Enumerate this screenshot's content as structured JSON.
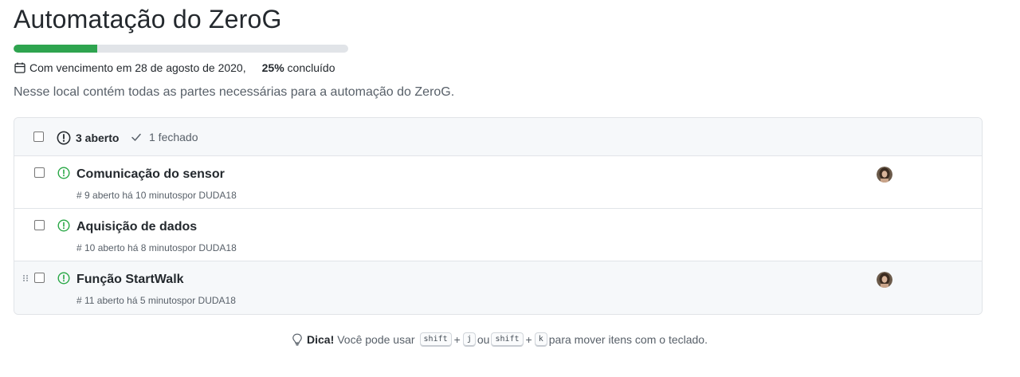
{
  "milestone": {
    "title": "Automatação do ZeroG",
    "progress": 0.25,
    "due_text": "Com vencimento em 28 de agosto de 2020,",
    "percent_value": "25%",
    "percent_label": "concluído",
    "description": "Nesse local contém todas as partes necessárias para a automação do ZeroG."
  },
  "colors": {
    "accent_green": "#2ea44f",
    "progress_track": "#e1e4e8",
    "open_icon": "#28a745"
  },
  "header": {
    "open_label": "3 aberto",
    "closed_label": "1 fechado"
  },
  "issues": [
    {
      "title": "Comunicação do sensor",
      "meta": "# 9 aberto há 10 minutospor DUDA18",
      "icon": "issue-opened-icon",
      "has_avatar": true
    },
    {
      "title": "Aquisição de dados",
      "meta": "# 10 aberto há 8 minutospor DUDA18",
      "icon": "issue-opened-icon",
      "has_avatar": false
    },
    {
      "title": "Função StartWalk",
      "meta": "# 11 aberto há 5 minutospor DUDA18",
      "icon": "issue-opened-icon",
      "has_avatar": true
    }
  ],
  "tip": {
    "bold": "Dica!",
    "text1": "Você pode usar",
    "key_shift": "shift",
    "plus": "+",
    "key_j": "j",
    "or": "ou",
    "key_k": "k",
    "text2": "para mover itens com o teclado."
  }
}
